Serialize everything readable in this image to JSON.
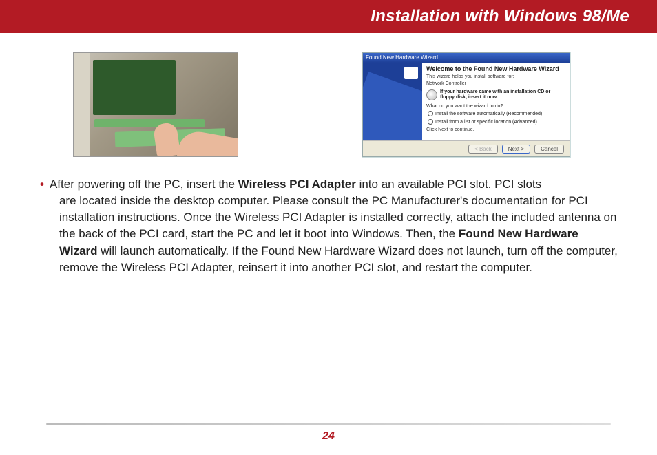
{
  "header": {
    "title": "Installation with Windows 98/Me"
  },
  "wizard": {
    "titlebar": "Found New Hardware Wizard",
    "heading": "Welcome to the Found New Hardware Wizard",
    "subtitle": "This wizard helps you install software for:",
    "device": "Network Controller",
    "cd_hint": "If your hardware came with an installation CD or floppy disk, insert it now.",
    "question": "What do you want the wizard to do?",
    "option1": "Install the software automatically (Recommended)",
    "option2": "Install from a list or specific location (Advanced)",
    "continue_hint": "Click Next to continue.",
    "buttons": {
      "back": "< Back",
      "next": "Next >",
      "cancel": "Cancel"
    }
  },
  "body": {
    "p1a": "After powering off the PC, insert the ",
    "p1_bold1": "Wireless PCI Adapter",
    "p1b": " into an available PCI slot. PCI slots",
    "p2": "are located inside the desktop computer.  Please consult the PC Manufacturer's documentation for PCI installation instructions.  Once the Wireless PCI Adapter is installed correctly, attach the included antenna on the back of the PCI card, start the PC and let it boot into Windows.  Then, the ",
    "p2_bold": "Found New Hardware Wizard",
    "p3": " will launch automatically. If the Found New Hardware Wizard does not launch, turn off the computer, remove the Wireless PCI Adapter, reinsert it into another PCI slot, and restart the computer."
  },
  "footer": {
    "page_number": "24"
  }
}
